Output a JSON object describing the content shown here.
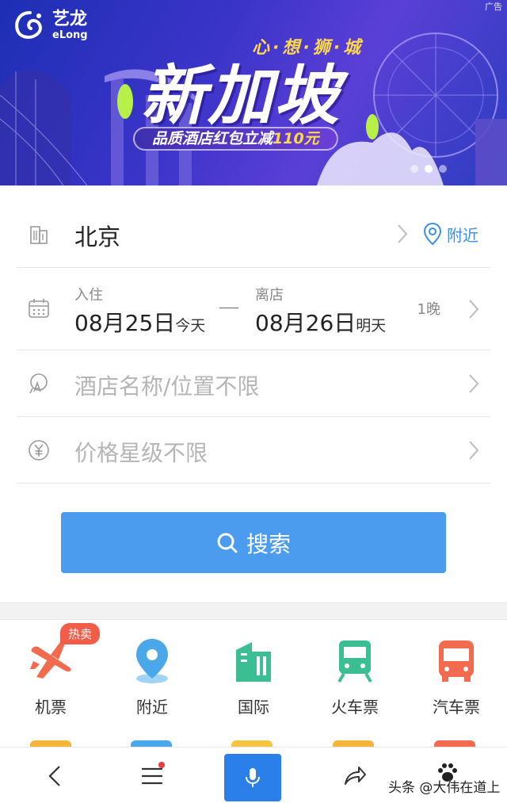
{
  "banner": {
    "logo_cn": "艺龙",
    "logo_en": "eLong",
    "ad_tag": "广告",
    "slogan": "心·想·狮·城",
    "headline": "新加坡",
    "promo_prefix": "品质酒店红包立减",
    "promo_amount": "110元",
    "slides_total": 3,
    "slides_active": 2
  },
  "form": {
    "city": "北京",
    "nearby_label": "附近",
    "checkin_label": "入住",
    "checkin_date": "08月25日",
    "checkin_day": "今天",
    "checkout_label": "离店",
    "checkout_date": "08月26日",
    "checkout_day": "明天",
    "nights": "1晚",
    "keyword_placeholder": "酒店名称/位置不限",
    "price_placeholder": "价格星级不限",
    "search_label": "搜索"
  },
  "categories": [
    {
      "label": "机票",
      "badge": "热卖",
      "icon": "airplane-icon",
      "color": "#f26b4f"
    },
    {
      "label": "附近",
      "icon": "location-pin-icon",
      "color": "#4aa8ea"
    },
    {
      "label": "国际",
      "icon": "buildings-icon",
      "color": "#3bbf92"
    },
    {
      "label": "火车票",
      "icon": "train-icon",
      "color": "#3bbf92"
    },
    {
      "label": "汽车票",
      "icon": "bus-icon",
      "color": "#f26b4f"
    }
  ],
  "bottom_bar": {
    "icons": [
      "back-icon",
      "menu-icon",
      "microphone-icon",
      "share-icon",
      "paw-icon"
    ]
  },
  "watermark": "头条 @大伟在道上",
  "colors": {
    "accent_blue": "#4b9cee",
    "mic_blue": "#2b7fe9",
    "hot_red": "#f25d4a",
    "banner_yellow": "#ffd84a"
  }
}
